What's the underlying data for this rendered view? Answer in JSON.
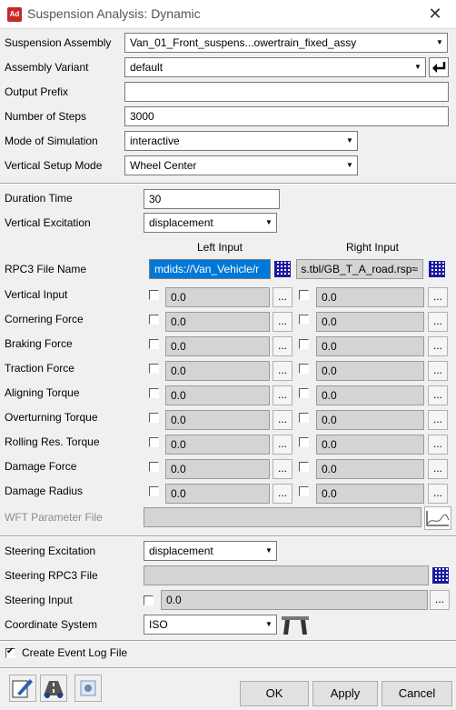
{
  "window": {
    "title": "Suspension Analysis: Dynamic",
    "app_icon_text": "Ad",
    "close_glyph": "✕"
  },
  "top": {
    "suspension_assembly": {
      "label": "Suspension Assembly",
      "value": "Van_01_Front_suspens...owertrain_fixed_assy"
    },
    "assembly_variant": {
      "label": "Assembly Variant",
      "value": "default"
    },
    "output_prefix": {
      "label": "Output Prefix",
      "value": ""
    },
    "number_of_steps": {
      "label": "Number of Steps",
      "value": "3000"
    },
    "mode_of_simulation": {
      "label": "Mode of Simulation",
      "value": "interactive"
    },
    "vertical_setup_mode": {
      "label": "Vertical Setup Mode",
      "value": "Wheel Center"
    }
  },
  "excitation": {
    "duration_time": {
      "label": "Duration Time",
      "value": "30"
    },
    "vertical_excitation": {
      "label": "Vertical Excitation",
      "value": "displacement"
    },
    "left_header": "Left Input",
    "right_header": "Right Input",
    "rpc3": {
      "label": "RPC3 File Name",
      "left_value": "mdids://Van_Vehicle/r",
      "right_value": "≈s.tbl/GB_T_A_road.rsp"
    },
    "rows": [
      {
        "label": "Vertical Input",
        "left": "0.0",
        "right": "0.0"
      },
      {
        "label": "Cornering Force",
        "left": "0.0",
        "right": "0.0"
      },
      {
        "label": "Braking Force",
        "left": "0.0",
        "right": "0.0"
      },
      {
        "label": "Traction Force",
        "left": "0.0",
        "right": "0.0"
      },
      {
        "label": "Aligning Torque",
        "left": "0.0",
        "right": "0.0"
      },
      {
        "label": "Overturning Torque",
        "left": "0.0",
        "right": "0.0"
      },
      {
        "label": "Rolling Res. Torque",
        "left": "0.0",
        "right": "0.0"
      },
      {
        "label": "Damage Force",
        "left": "0.0",
        "right": "0.0"
      },
      {
        "label": "Damage Radius",
        "left": "0.0",
        "right": "0.0"
      }
    ],
    "wft_parameter_file": {
      "label": "WFT Parameter File",
      "value": ""
    }
  },
  "steering": {
    "steering_excitation": {
      "label": "Steering Excitation",
      "value": "displacement"
    },
    "steering_rpc3_file": {
      "label": "Steering RPC3 File",
      "value": ""
    },
    "steering_input": {
      "label": "Steering Input",
      "value": "0.0"
    },
    "coordinate_system": {
      "label": "Coordinate System",
      "value": "ISO"
    }
  },
  "event_log": {
    "label": "Create Event Log File",
    "checked": true
  },
  "buttons": {
    "ok": "OK",
    "apply": "Apply",
    "cancel": "Cancel"
  },
  "icons": [
    "edit-icon",
    "road-icon",
    "settings-icon",
    "browse-grid-icon",
    "dots-icon",
    "plot-icon",
    "wheel-center-icon"
  ],
  "colors": {
    "selection": "#0078d7",
    "grid_icon": "#1a1aa0",
    "title_icon": "#c62828"
  }
}
